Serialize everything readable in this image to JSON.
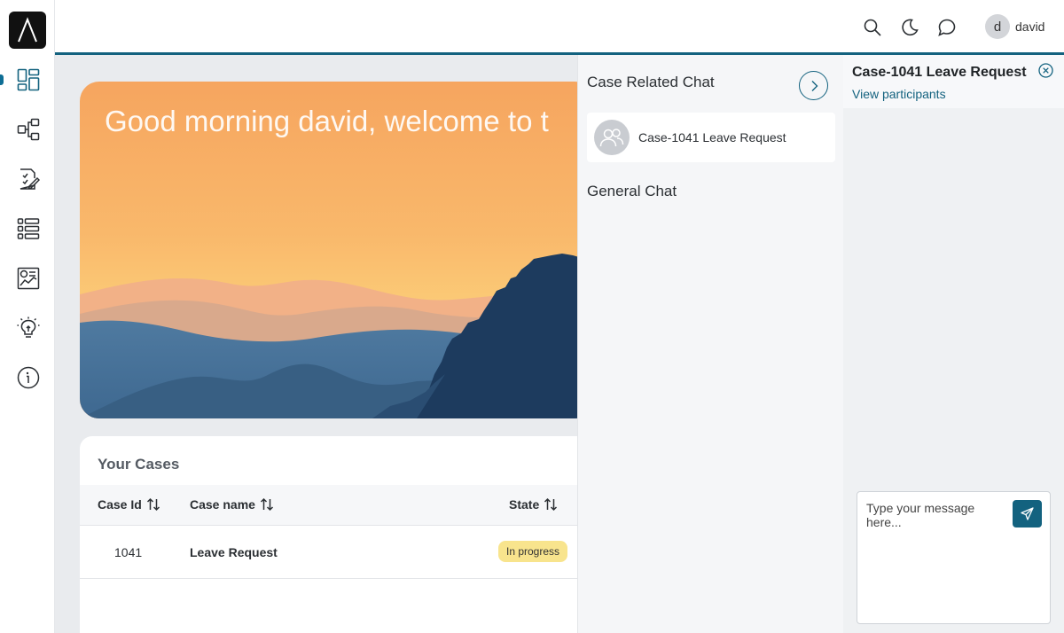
{
  "app": {
    "user_initial": "d",
    "user_name": "david"
  },
  "nav": {
    "items": [
      {
        "icon": "dashboard-icon",
        "active": true
      },
      {
        "icon": "process-flow-icon",
        "active": false
      },
      {
        "icon": "task-form-icon",
        "active": false
      },
      {
        "icon": "list-icon",
        "active": false
      },
      {
        "icon": "analytics-report-icon",
        "active": false
      },
      {
        "icon": "lightbulb-icon",
        "active": false
      },
      {
        "icon": "info-icon",
        "active": false
      }
    ]
  },
  "topbar": {
    "icons": [
      "search-icon",
      "dark-mode-icon",
      "chat-icon"
    ]
  },
  "hero": {
    "greeting": "Good morning david, welcome to t"
  },
  "cases": {
    "title": "Your Cases",
    "columns": {
      "case_id": "Case Id",
      "case_name": "Case name",
      "state": "State"
    },
    "rows": [
      {
        "case_id": "1041",
        "case_name": "Leave Request",
        "state": "In progress"
      }
    ]
  },
  "chat_list": {
    "case_related_title": "Case Related Chat",
    "case_chats": [
      {
        "label": "Case-1041 Leave Request"
      }
    ],
    "general_title": "General Chat"
  },
  "conversation": {
    "title": "Case-1041 Leave Request",
    "participants_link": "View participants",
    "input_placeholder": "Type your message here..."
  },
  "colors": {
    "accent": "#13627f",
    "badge_in_progress": "#f8e48d",
    "rail_active": "#0e6e95"
  }
}
